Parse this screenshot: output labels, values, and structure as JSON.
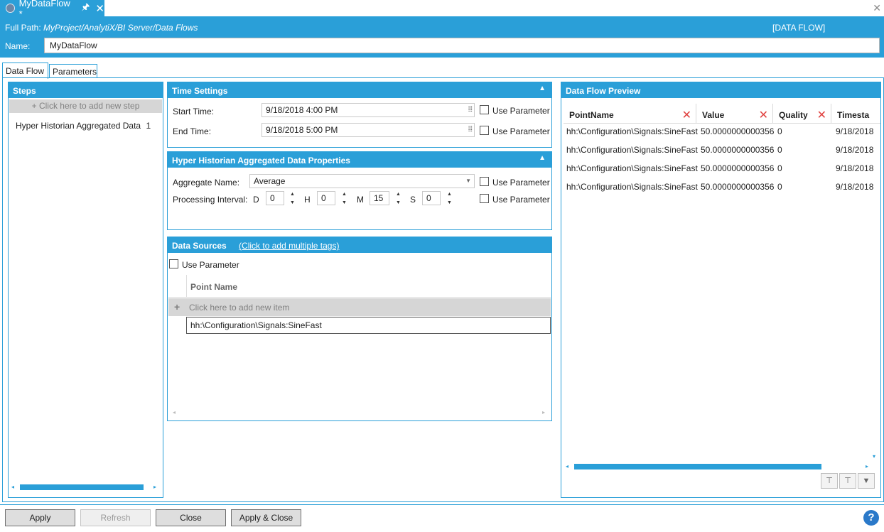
{
  "document_tab": {
    "title": "MyDataFlow *",
    "pin": "🖈",
    "close": "✕"
  },
  "window": {
    "close": "✕"
  },
  "header": {
    "full_path_label": "Full Path:",
    "full_path_value": "MyProject/AnalytiX/BI Server/Data Flows",
    "kind": "[DATA FLOW]",
    "name_label": "Name:",
    "name_value": "MyDataFlow"
  },
  "tabs": [
    {
      "label": "Data Flow"
    },
    {
      "label": "Parameters"
    }
  ],
  "steps": {
    "title": "Steps",
    "add_label": "+  Click here to add new step",
    "items": [
      {
        "label": "Hyper Historian Aggregated Data",
        "count": "1"
      }
    ]
  },
  "time_settings": {
    "title": "Time Settings",
    "start_label": "Start Time:",
    "start_value": "9/18/2018 4:00 PM",
    "end_label": "End Time:",
    "end_value": "9/18/2018 5:00 PM",
    "use_parameter": "Use Parameter"
  },
  "aggregate_props": {
    "title": "Hyper Historian Aggregated Data Properties",
    "aggregate_label": "Aggregate Name:",
    "aggregate_value": "Average",
    "interval_label": "Processing Interval:",
    "d_label": "D",
    "d_value": "0",
    "h_label": "H",
    "h_value": "0",
    "m_label": "M",
    "m_value": "15",
    "s_label": "S",
    "s_value": "0",
    "use_parameter": "Use Parameter"
  },
  "data_sources": {
    "title": "Data Sources",
    "link": "(Click to add multiple tags)",
    "use_parameter": "Use Parameter",
    "column": "Point Name",
    "add_label": "Click here to add new item",
    "rows": [
      "hh:\\Configuration\\Signals:SineFast"
    ]
  },
  "preview": {
    "title": "Data Flow Preview",
    "columns": [
      "PointName",
      "Value",
      "Quality",
      "Timesta"
    ],
    "rows": [
      [
        "hh:\\Configuration\\Signals:SineFast",
        "50.0000000000356",
        "0",
        "9/18/2018"
      ],
      [
        "hh:\\Configuration\\Signals:SineFast",
        "50.0000000000356",
        "0",
        "9/18/2018"
      ],
      [
        "hh:\\Configuration\\Signals:SineFast",
        "50.0000000000356",
        "0",
        "9/18/2018"
      ],
      [
        "hh:\\Configuration\\Signals:SineFast",
        "50.0000000000356",
        "0",
        "9/18/2018"
      ]
    ]
  },
  "footer": {
    "apply": "Apply",
    "refresh": "Refresh",
    "close": "Close",
    "apply_close": "Apply & Close",
    "help": "?"
  },
  "colors": {
    "accent": "#2a9fd8",
    "remove": "#e0413f",
    "help": "#2a79c9"
  }
}
